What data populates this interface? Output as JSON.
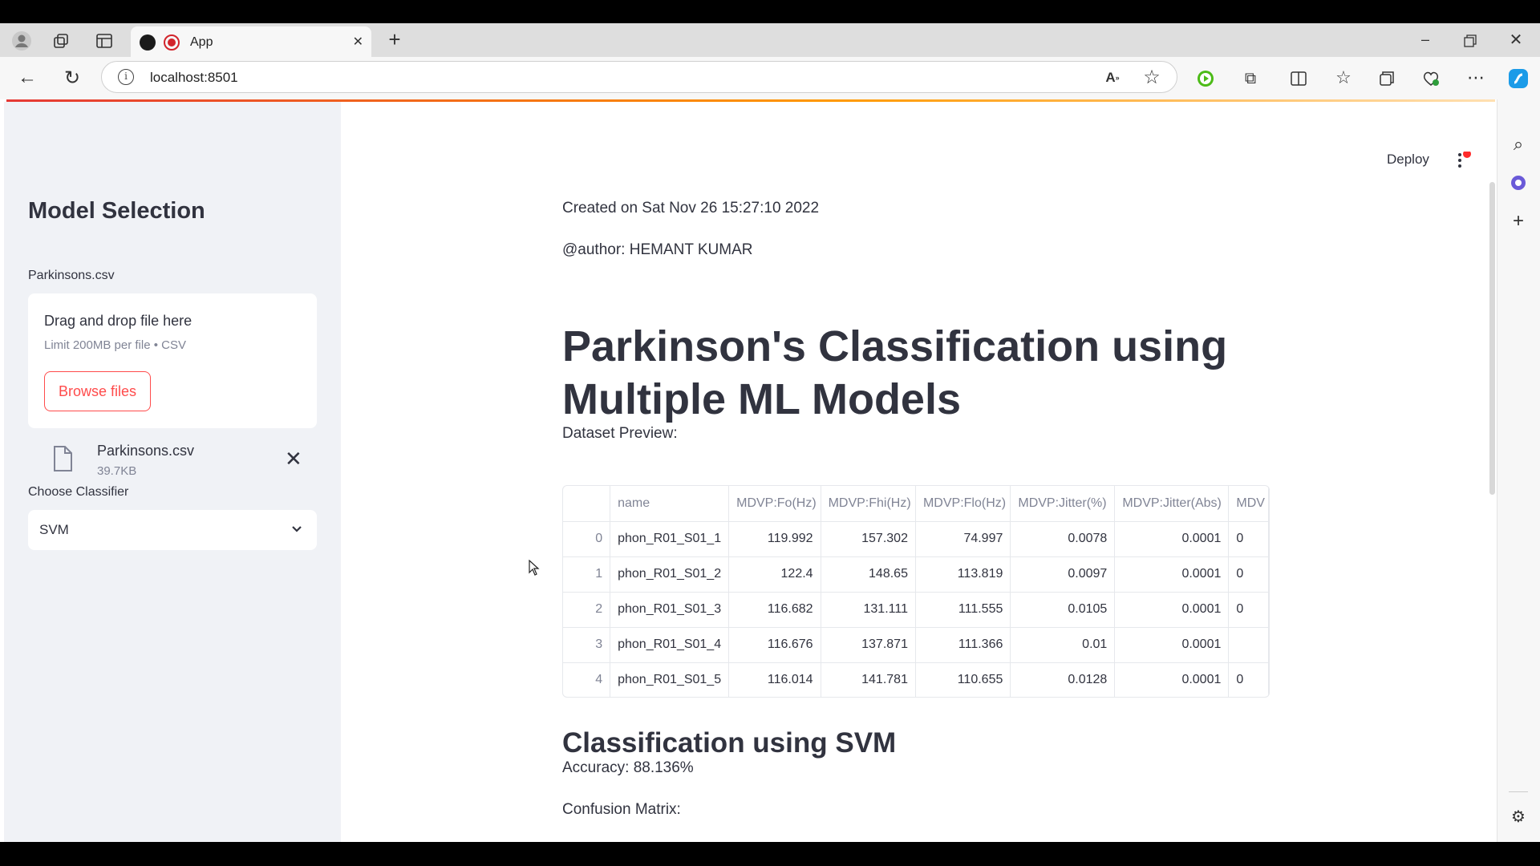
{
  "browser": {
    "tab_title": "App",
    "url": "localhost:8501"
  },
  "sidebar": {
    "title": "Model Selection",
    "uploader_label": "Parkinsons.csv",
    "drag_text": "Drag and drop file here",
    "limit_text": "Limit 200MB per file • CSV",
    "browse_label": "Browse files",
    "file_name": "Parkinsons.csv",
    "file_size": "39.7KB",
    "classifier_label": "Choose Classifier",
    "classifier_value": "SVM"
  },
  "header": {
    "deploy_label": "Deploy"
  },
  "main": {
    "created": "Created on Sat Nov 26 15:27:10 2022",
    "author": "@author: HEMANT KUMAR",
    "title": "Parkinson's Classification using Multiple ML Models",
    "preview_label": "Dataset Preview:",
    "section_title": "Classification using SVM",
    "accuracy": "Accuracy: 88.136%",
    "confusion_label": "Confusion Matrix:"
  },
  "table": {
    "columns": [
      "",
      "name",
      "MDVP:Fo(Hz)",
      "MDVP:Fhi(Hz)",
      "MDVP:Flo(Hz)",
      "MDVP:Jitter(%)",
      "MDVP:Jitter(Abs)",
      "MDV"
    ],
    "rows": [
      [
        "0",
        "phon_R01_S01_1",
        "119.992",
        "157.302",
        "74.997",
        "0.0078",
        "0.0001",
        "0"
      ],
      [
        "1",
        "phon_R01_S01_2",
        "122.4",
        "148.65",
        "113.819",
        "0.0097",
        "0.0001",
        "0"
      ],
      [
        "2",
        "phon_R01_S01_3",
        "116.682",
        "131.111",
        "111.555",
        "0.0105",
        "0.0001",
        "0"
      ],
      [
        "3",
        "phon_R01_S01_4",
        "116.676",
        "137.871",
        "111.366",
        "0.01",
        "0.0001",
        ""
      ],
      [
        "4",
        "phon_R01_S01_5",
        "116.014",
        "141.781",
        "110.655",
        "0.0128",
        "0.0001",
        "0"
      ]
    ]
  },
  "colors": {
    "accent": "#ff4b4b",
    "text": "#31333f",
    "muted": "#808495",
    "sidebar_bg": "#f0f2f6"
  }
}
